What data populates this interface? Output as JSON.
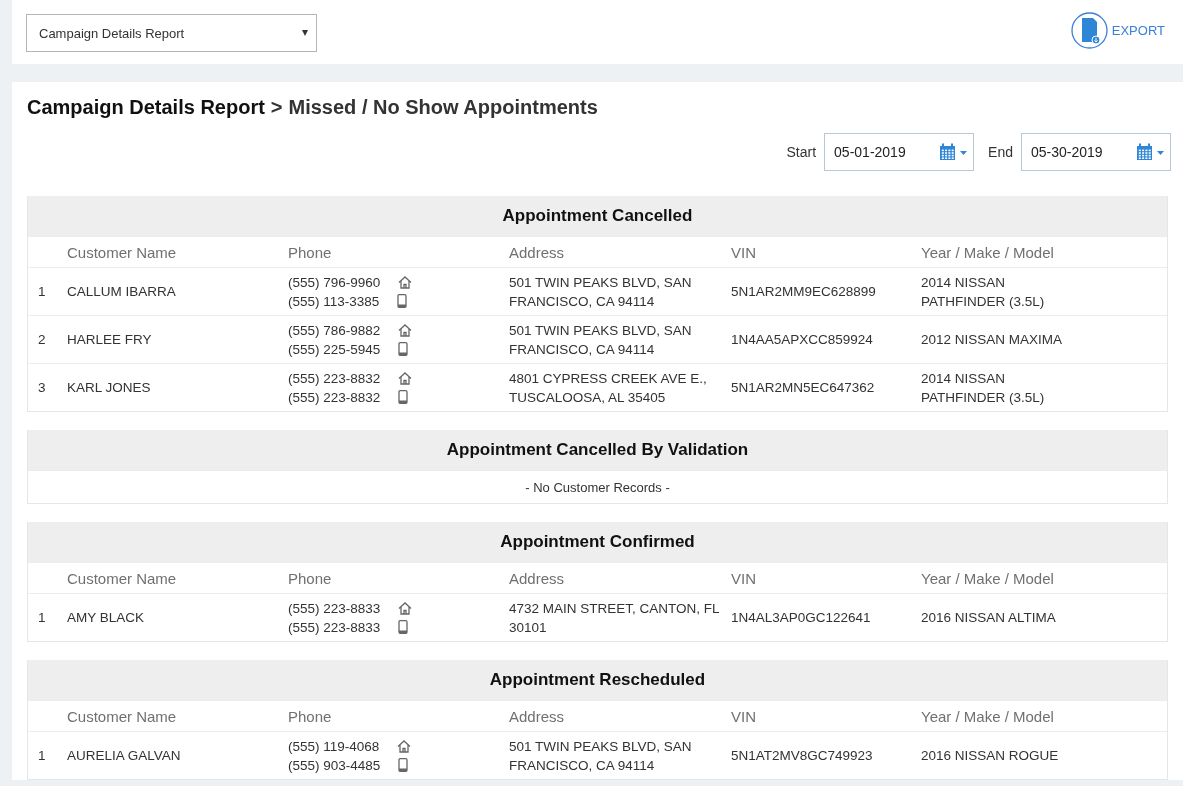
{
  "report_select": {
    "value": "Campaign Details Report"
  },
  "export_button": {
    "label": "EXPORT"
  },
  "breadcrumb": {
    "parent": "Campaign Details Report",
    "separator": ">",
    "current": "Missed / No Show Appointments"
  },
  "date_range": {
    "start_label": "Start",
    "start_value": "05-01-2019",
    "end_label": "End",
    "end_value": "05-30-2019"
  },
  "sections": [
    {
      "title": "Appointment Cancelled",
      "columns": [
        "Customer Name",
        "Phone",
        "Address",
        "VIN",
        "Year / Make / Model"
      ],
      "rows": [
        {
          "index": "1",
          "name": "CALLUM IBARRA",
          "phones": [
            {
              "kind": "home",
              "number": "(555) 796-9960"
            },
            {
              "kind": "mobile",
              "number": "(555) 113-3385"
            }
          ],
          "address": "501 TWIN PEAKS BLVD, SAN FRANCISCO, CA 94114",
          "vin": "5N1AR2MM9EC628899",
          "vehicle": "2014 NISSAN PATHFINDER (3.5L)"
        },
        {
          "index": "2",
          "name": "HARLEE FRY",
          "phones": [
            {
              "kind": "home",
              "number": "(555) 786-9882"
            },
            {
              "kind": "mobile",
              "number": "(555) 225-5945"
            }
          ],
          "address": "501 TWIN PEAKS BLVD, SAN FRANCISCO, CA 94114",
          "vin": "1N4AA5APXCC859924",
          "vehicle": "2012 NISSAN MAXIMA"
        },
        {
          "index": "3",
          "name": "KARL JONES",
          "phones": [
            {
              "kind": "home",
              "number": "(555) 223-8832"
            },
            {
              "kind": "mobile",
              "number": "(555) 223-8832"
            }
          ],
          "address": "4801 CYPRESS CREEK AVE E., TUSCALOOSA, AL 35405",
          "vin": "5N1AR2MN5EC647362",
          "vehicle": "2014 NISSAN PATHFINDER (3.5L)"
        }
      ]
    },
    {
      "title": "Appointment Cancelled By Validation",
      "empty_message": "- No Customer Records -"
    },
    {
      "title": "Appointment Confirmed",
      "columns": [
        "Customer Name",
        "Phone",
        "Address",
        "VIN",
        "Year / Make / Model"
      ],
      "rows": [
        {
          "index": "1",
          "name": "AMY BLACK",
          "phones": [
            {
              "kind": "home",
              "number": "(555) 223-8833"
            },
            {
              "kind": "mobile",
              "number": "(555) 223-8833"
            }
          ],
          "address": "4732 MAIN STREET, CANTON, FL 30101",
          "vin": "1N4AL3AP0GC122641",
          "vehicle": "2016 NISSAN ALTIMA"
        }
      ]
    },
    {
      "title": "Appointment Rescheduled",
      "columns": [
        "Customer Name",
        "Phone",
        "Address",
        "VIN",
        "Year / Make / Model"
      ],
      "rows": [
        {
          "index": "1",
          "name": "AURELIA GALVAN",
          "phones": [
            {
              "kind": "home",
              "number": "(555) 119-4068"
            },
            {
              "kind": "mobile",
              "number": "(555) 903-4485"
            }
          ],
          "address": "501 TWIN PEAKS BLVD, SAN FRANCISCO, CA 94114",
          "vin": "5N1AT2MV8GC749923",
          "vehicle": "2016 NISSAN ROGUE"
        }
      ]
    }
  ]
}
